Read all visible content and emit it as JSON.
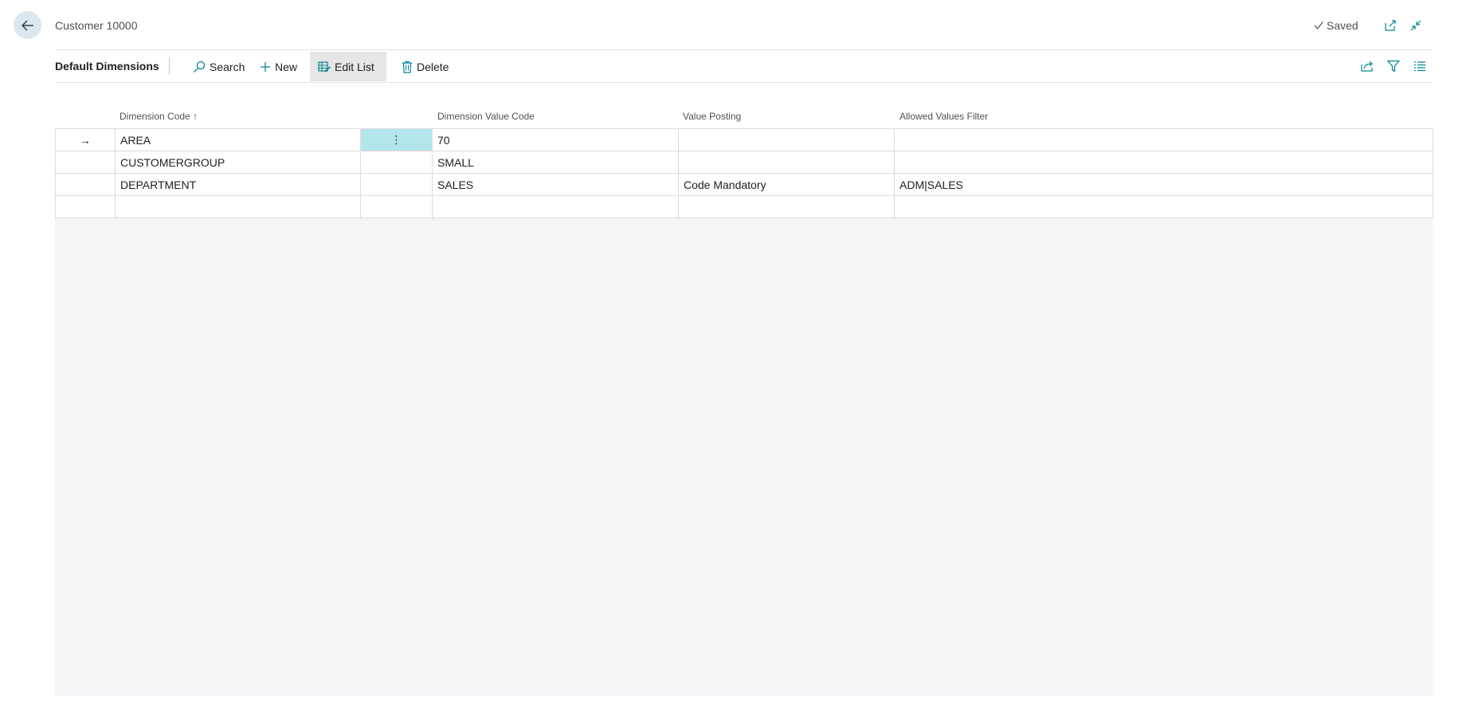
{
  "header": {
    "title": "Customer 10000",
    "saved_label": "Saved"
  },
  "actionbar": {
    "caption": "Default Dimensions",
    "search_label": "Search",
    "new_label": "New",
    "edit_list_label": "Edit List",
    "delete_label": "Delete"
  },
  "grid": {
    "columns": {
      "dimension_code": "Dimension Code",
      "dimension_code_sort": "↑",
      "dimension_value_code": "Dimension Value Code",
      "value_posting": "Value Posting",
      "allowed_values_filter": "Allowed Values Filter"
    },
    "row_menu_glyph": "⋮",
    "current_row_marker": "→",
    "rows": [
      {
        "dimension_code": "AREA",
        "dimension_value_code": "70",
        "value_posting": "",
        "allowed_values_filter": ""
      },
      {
        "dimension_code": "CUSTOMERGROUP",
        "dimension_value_code": "SMALL",
        "value_posting": "",
        "allowed_values_filter": ""
      },
      {
        "dimension_code": "DEPARTMENT",
        "dimension_value_code": "SALES",
        "value_posting": "Code Mandatory",
        "allowed_values_filter": "ADM|SALES"
      },
      {
        "dimension_code": "",
        "dimension_value_code": "",
        "value_posting": "",
        "allowed_values_filter": ""
      }
    ]
  },
  "colors": {
    "accent": "#00838f",
    "selected_cell": "#b3e5ec",
    "back_button_bg": "#dbe7ef"
  }
}
